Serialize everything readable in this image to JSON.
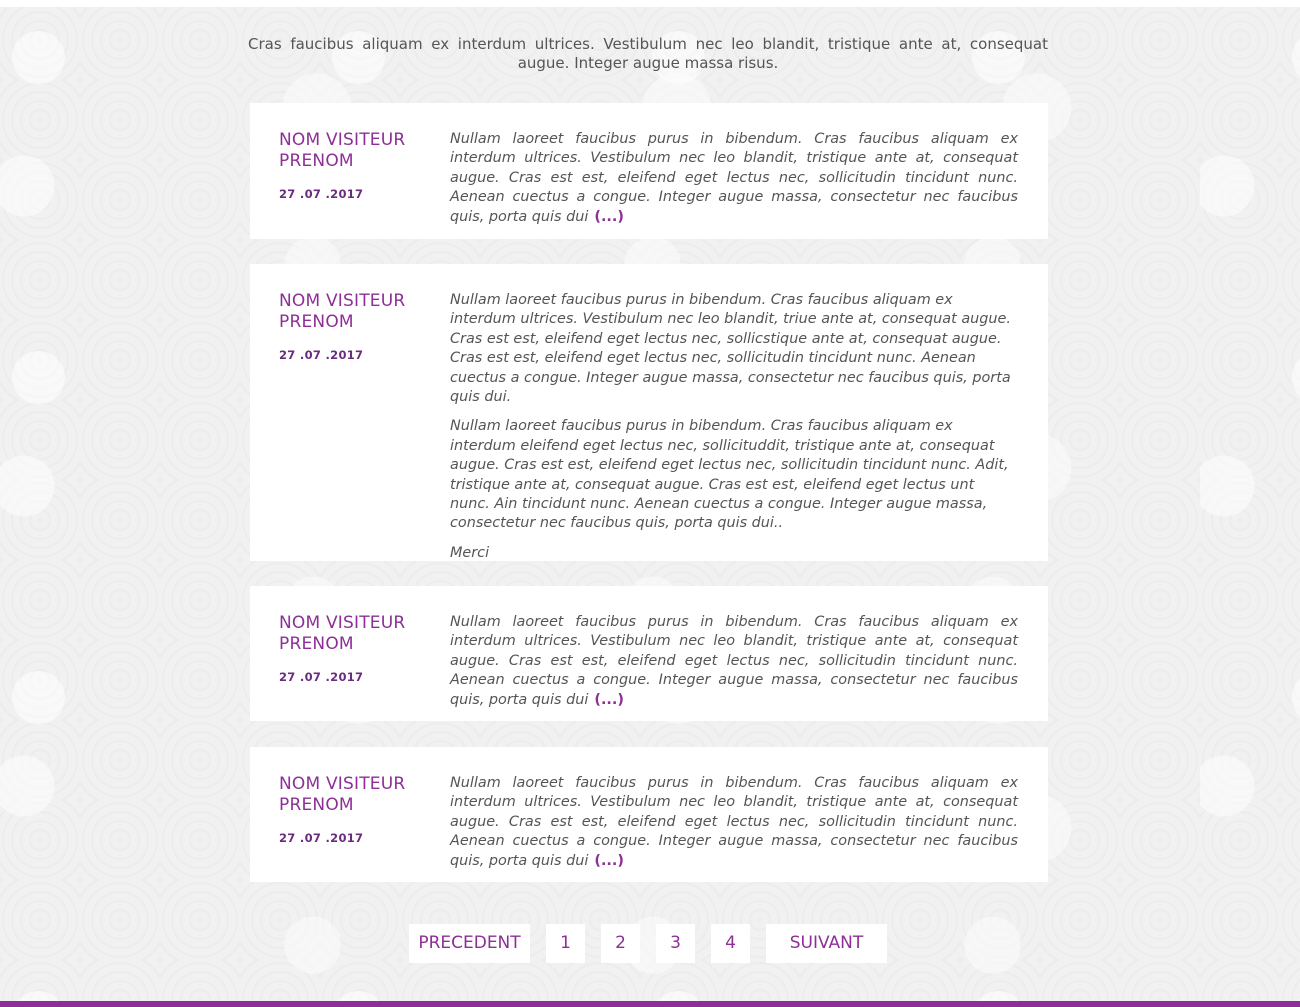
{
  "intro": "Cras faucibus aliquam ex interdum ultrices. Vestibulum nec leo blandit, tristique ante at, consequat augue. Integer augue massa risus.",
  "reviews": [
    {
      "name": "NOM VISITEUR PRENOM",
      "date": "27 .07 .2017",
      "paragraphs": [
        "Nullam laoreet faucibus purus in bibendum. Cras faucibus aliquam ex interdum ultrices. Vestibulum nec leo blandit, tristique ante at, consequat augue. Cras est est, eleifend eget lectus nec, sollicitudin tincidunt nunc. Aenean cuectus a congue. Integer augue massa, consectetur nec faucibus quis, porta quis dui"
      ],
      "more": "(...)"
    },
    {
      "name": "NOM VISITEUR PRENOM",
      "date": "27 .07 .2017",
      "paragraphs": [
        "Nullam laoreet faucibus purus in bibendum. Cras faucibus aliquam ex interdum ultrices. Vestibulum nec leo blandit, triue ante at, consequat augue. Cras est est, eleifend eget lectus nec, sollicstique ante at, consequat augue. Cras est est, eleifend eget lectus nec, sollicitudin tincidunt nunc. Aenean cuectus a congue. Integer augue massa, consectetur nec faucibus quis, porta quis dui.",
        "Nullam laoreet faucibus purus in bibendum. Cras faucibus aliquam ex interdum eleifend eget lectus nec, sollicituddit, tristique ante at, consequat augue. Cras est est, eleifend eget lectus nec, sollicitudin tincidunt nunc. Adit, tristique ante at, consequat augue. Cras est est, eleifend eget lectus unt nunc. Ain tincidunt nunc. Aenean cuectus a congue. Integer augue massa, consectetur nec faucibus quis, porta quis dui..",
        "Merci"
      ]
    },
    {
      "name": "NOM VISITEUR PRENOM",
      "date": "27 .07 .2017",
      "paragraphs": [
        "Nullam laoreet faucibus purus in bibendum. Cras faucibus aliquam ex interdum ultrices. Vestibulum nec leo blandit, tristique ante at, consequat augue. Cras est est, eleifend eget lectus nec, sollicitudin tincidunt nunc. Aenean cuectus a congue. Integer augue massa, consectetur nec faucibus quis, porta quis dui"
      ],
      "more": "(...)"
    },
    {
      "name": "NOM VISITEUR PRENOM",
      "date": "27 .07 .2017",
      "paragraphs": [
        "Nullam laoreet faucibus purus in bibendum. Cras faucibus aliquam ex interdum ultrices. Vestibulum nec leo blandit, tristique ante at, consequat augue. Cras est est, eleifend eget lectus nec, sollicitudin tincidunt nunc. Aenean cuectus a congue. Integer augue massa, consectetur nec faucibus quis, porta quis dui"
      ],
      "more": "(...)"
    }
  ],
  "pagination": {
    "prev": "PRECEDENT",
    "pages": [
      "1",
      "2",
      "3",
      "4"
    ],
    "next": "SUIVANT"
  },
  "colors": {
    "accent": "#8d2f96",
    "date": "#6a2d7e",
    "text": "#555555",
    "card": "#ffffff",
    "background": "#f1f1f1"
  }
}
